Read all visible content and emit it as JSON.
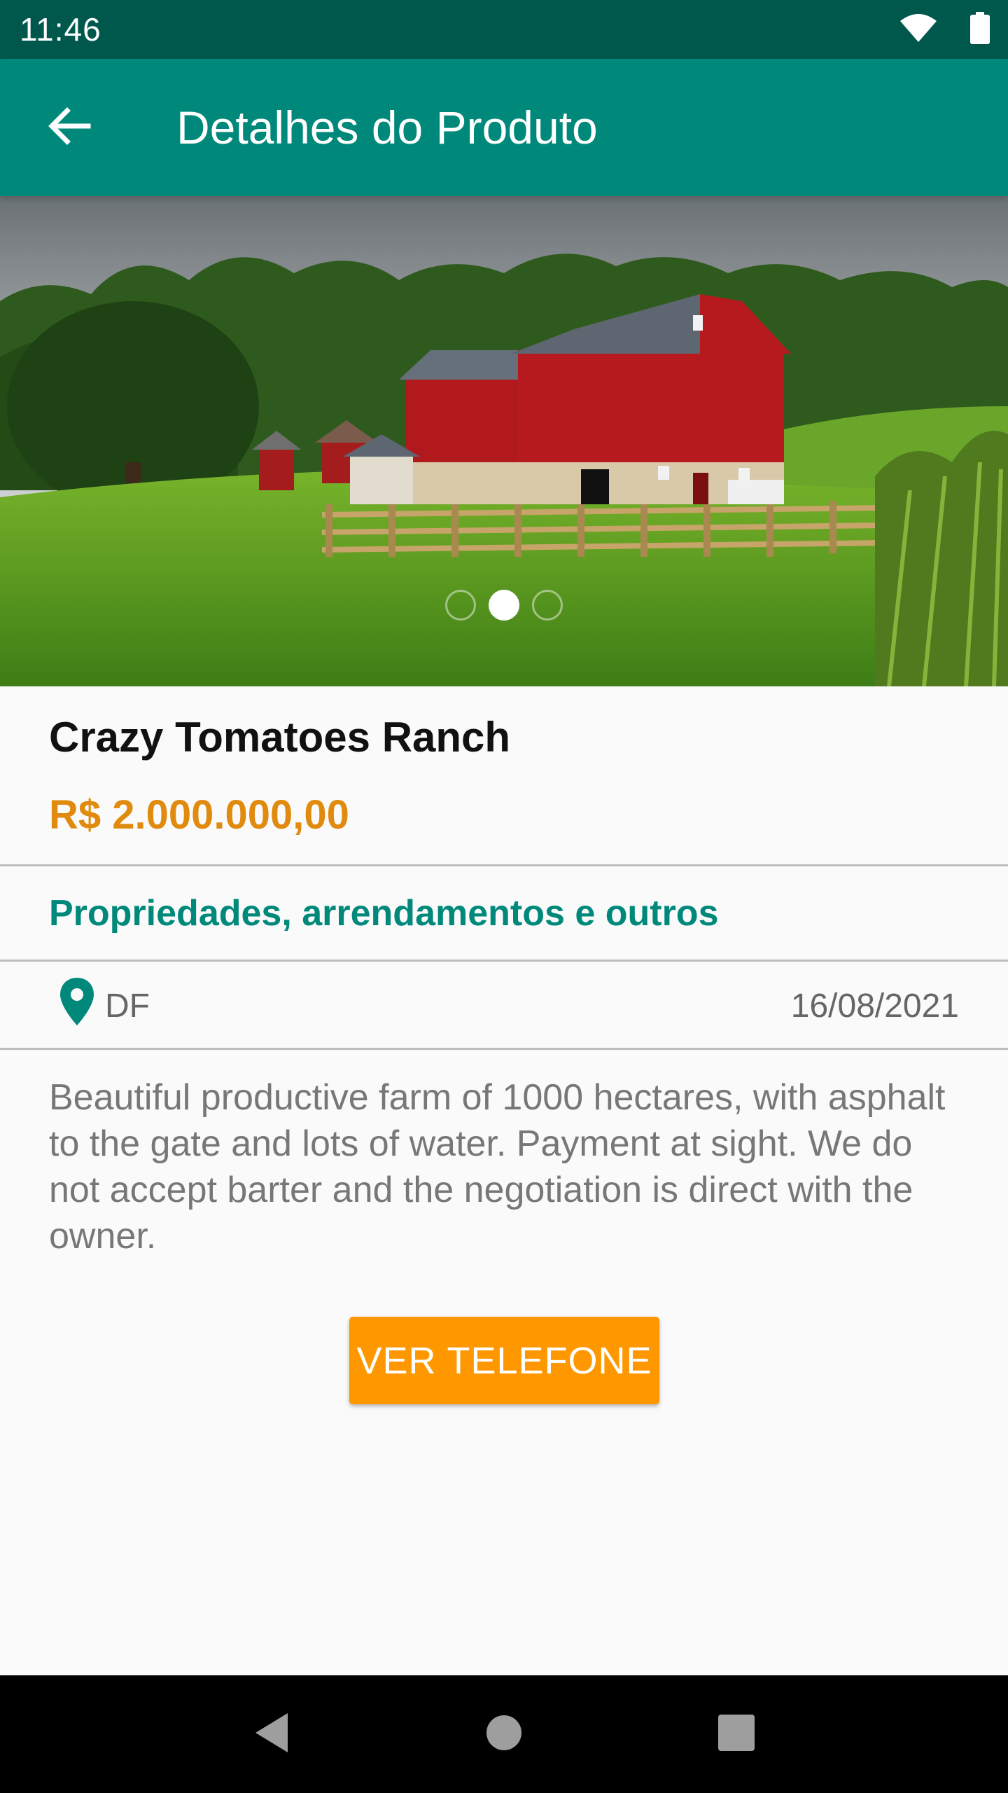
{
  "status_bar": {
    "time": "11:46",
    "icons": [
      "wifi-icon",
      "battery-icon"
    ]
  },
  "app_bar": {
    "title": "Detalhes do Produto",
    "back_icon": "arrow-back-icon"
  },
  "carousel": {
    "image_description": "red barn farm",
    "page_count": 3,
    "active_index": 1
  },
  "product": {
    "title": "Crazy Tomatoes Ranch",
    "price": "R$ 2.000.000,00",
    "category": "Propriedades, arrendamentos e outros",
    "location": "DF",
    "date": "16/08/2021",
    "description": "Beautiful productive farm of 1000 hectares, with asphalt to the gate and lots of water. Payment at sight. We do not accept barter and the negotiation is direct with the owner."
  },
  "actions": {
    "phone_button_label": "VER TELEFONE"
  },
  "colors": {
    "primary": "#00897b",
    "primary_dark": "#00584d",
    "accent": "#ff9800",
    "price": "#e08a0e"
  }
}
